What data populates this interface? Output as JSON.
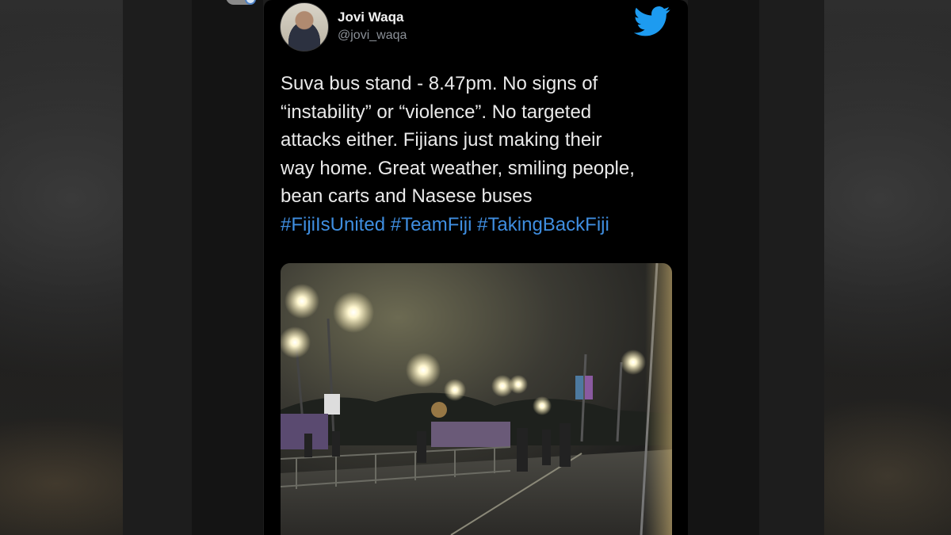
{
  "tweet": {
    "author": {
      "display_name": "Jovi Waqa",
      "handle": "@jovi_waqa"
    },
    "text_lines": [
      "Suva bus stand - 8.47pm. No signs of",
      "“instability” or “violence”. No targeted",
      "attacks either. Fijians just making their",
      "way home. Great weather, smiling people,",
      "bean carts and Nasese buses"
    ],
    "hashtags": "#FijiIsUnited #TeamFiji #TakingBackFiji",
    "media_alt": "night photo of street lights over a bus stand with people walking"
  },
  "icons": {
    "brand": "twitter-bird-icon",
    "avatar": "avatar"
  },
  "colors": {
    "card_background": "#000000",
    "text": "#eaeaea",
    "handle": "#8b9097",
    "hashtag": "#3f8ee0",
    "twitter_blue": "#1d9bf0"
  }
}
